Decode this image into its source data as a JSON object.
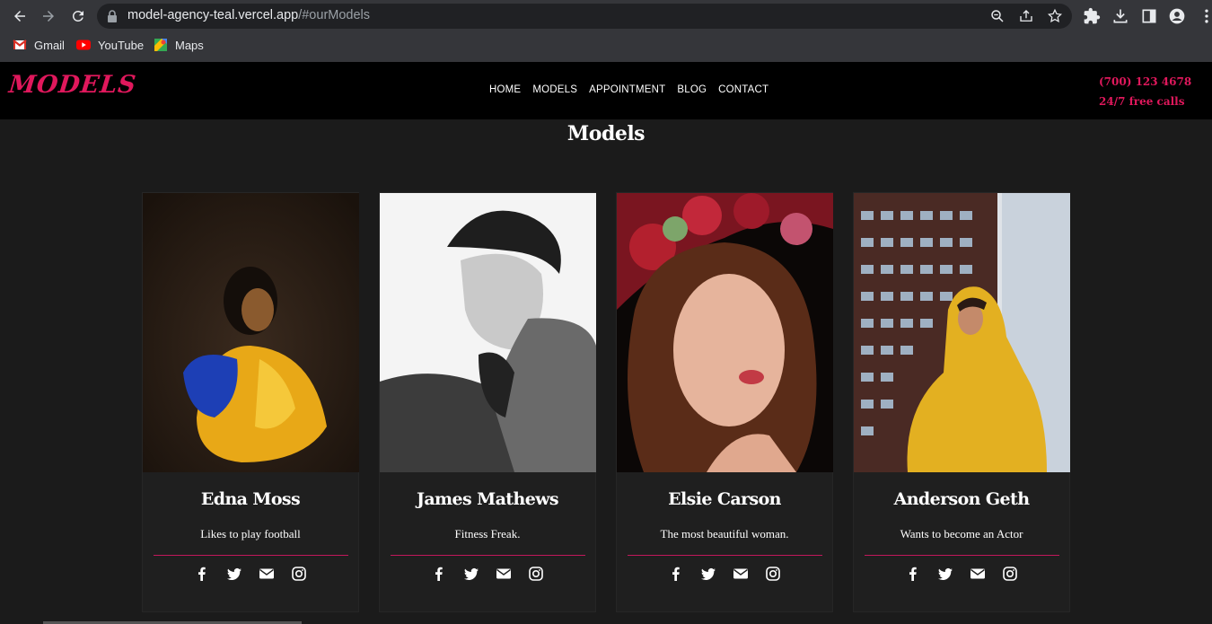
{
  "browser": {
    "url_host": "model-agency-teal.vercel.app",
    "url_path": "/#ourModels",
    "bookmarks": [
      {
        "label": "Gmail",
        "icon": "gmail-icon"
      },
      {
        "label": "YouTube",
        "icon": "youtube-icon"
      },
      {
        "label": "Maps",
        "icon": "maps-icon"
      }
    ]
  },
  "site": {
    "logo": "MODELS",
    "nav": [
      "HOME",
      "MODELS",
      "APPOINTMENT",
      "BLOG",
      "CONTACT"
    ],
    "phone": "(700) 123 4678",
    "calls": "24/7 free calls"
  },
  "section": {
    "title": "Models"
  },
  "models": [
    {
      "name": "Edna Moss",
      "desc": "Likes to play football"
    },
    {
      "name": "James Mathews",
      "desc": "Fitness Freak."
    },
    {
      "name": "Elsie Carson",
      "desc": "The most beautiful woman."
    },
    {
      "name": "Anderson Geth",
      "desc": "Wants to become an Actor"
    }
  ],
  "social_icons": [
    "facebook-icon",
    "twitter-icon",
    "envelope-icon",
    "instagram-icon"
  ],
  "colors": {
    "accent": "#e0185c",
    "page_bg": "#1b1b1b",
    "card_bg": "#1f1f1f",
    "header_bg": "#000000"
  }
}
